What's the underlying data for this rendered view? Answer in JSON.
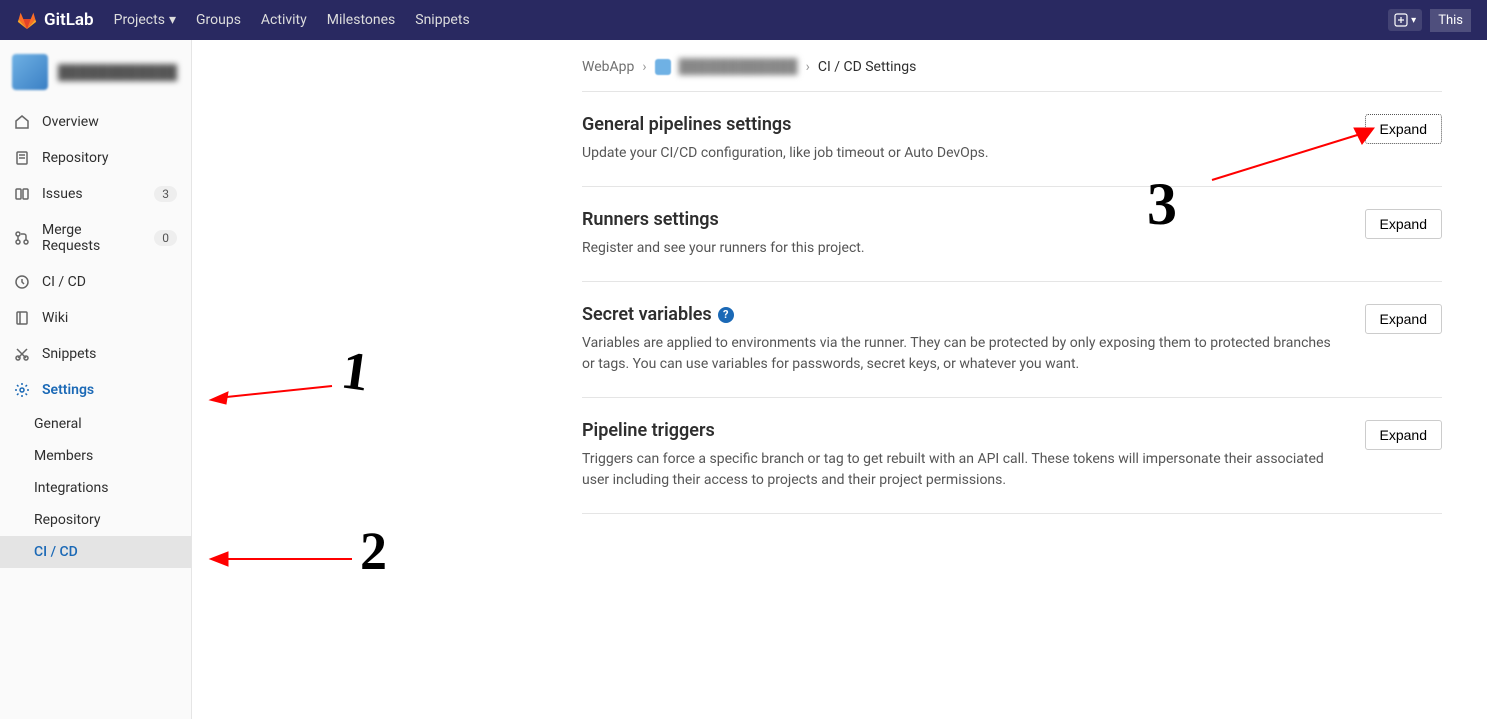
{
  "navbar": {
    "brand": "GitLab",
    "items": [
      "Projects",
      "Groups",
      "Activity",
      "Milestones",
      "Snippets"
    ],
    "right_this": "This"
  },
  "sidebar": {
    "project_name": "████████████",
    "items": [
      {
        "label": "Overview",
        "icon": "home"
      },
      {
        "label": "Repository",
        "icon": "doc"
      },
      {
        "label": "Issues",
        "icon": "issues",
        "badge": "3"
      },
      {
        "label": "Merge Requests",
        "icon": "merge",
        "badge": "0"
      },
      {
        "label": "CI / CD",
        "icon": "clock"
      },
      {
        "label": "Wiki",
        "icon": "book"
      },
      {
        "label": "Snippets",
        "icon": "scissors"
      },
      {
        "label": "Settings",
        "icon": "gear",
        "active": true
      }
    ],
    "subitems": [
      {
        "label": "General"
      },
      {
        "label": "Members"
      },
      {
        "label": "Integrations"
      },
      {
        "label": "Repository"
      },
      {
        "label": "CI / CD",
        "active": true
      }
    ]
  },
  "breadcrumbs": {
    "root": "WebApp",
    "project": "████████████",
    "current": "CI / CD Settings"
  },
  "sections": [
    {
      "title": "General pipelines settings",
      "desc": "Update your CI/CD configuration, like job timeout or Auto DevOps.",
      "expand": "Expand",
      "highlighted": true
    },
    {
      "title": "Runners settings",
      "desc": "Register and see your runners for this project.",
      "expand": "Expand"
    },
    {
      "title": "Secret variables",
      "desc": "Variables are applied to environments via the runner. They can be protected by only exposing them to protected branches or tags. You can use variables for passwords, secret keys, or whatever you want.",
      "expand": "Expand",
      "help": true
    },
    {
      "title": "Pipeline triggers",
      "desc": "Triggers can force a specific branch or tag to get rebuilt with an API call. These tokens will impersonate their associated user including their access to projects and their project permissions.",
      "expand": "Expand"
    }
  ],
  "annotations": {
    "n1": "1",
    "n2": "2",
    "n3": "3"
  }
}
